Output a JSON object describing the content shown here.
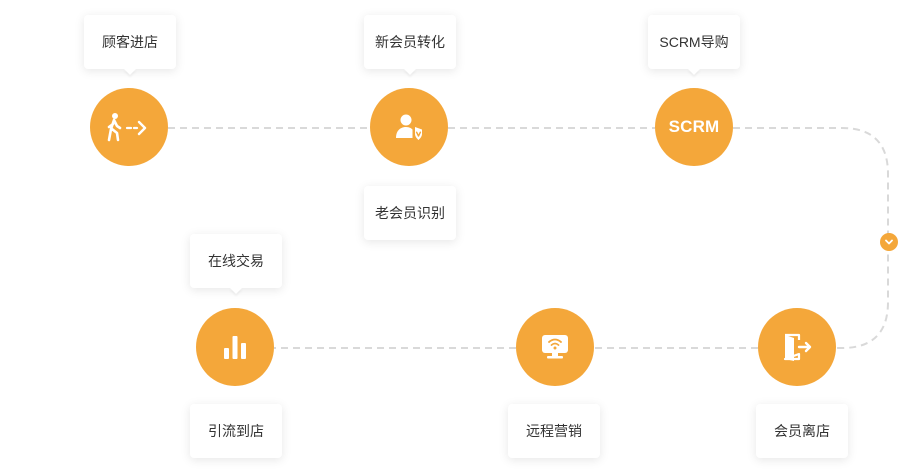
{
  "colors": {
    "accent": "#f4a73a",
    "connector": "#d9d9d9",
    "label_text": "#333333"
  },
  "stages": [
    {
      "label": "顾客进店",
      "icon": "walk-in-icon"
    },
    {
      "label": "新会员转化",
      "icon": "member-verified-icon",
      "secondary_label": "老会员识别"
    },
    {
      "label": "SCRM导购",
      "node_text": "SCRM"
    },
    {
      "label": "会员离店",
      "icon": "exit-door-icon"
    },
    {
      "label": "远程营销",
      "icon": "remote-monitor-icon"
    },
    {
      "label": "引流到店",
      "icon": "bar-chart-icon",
      "secondary_label": "在线交易"
    }
  ],
  "turn_marker_icon": "chevron-down-icon"
}
